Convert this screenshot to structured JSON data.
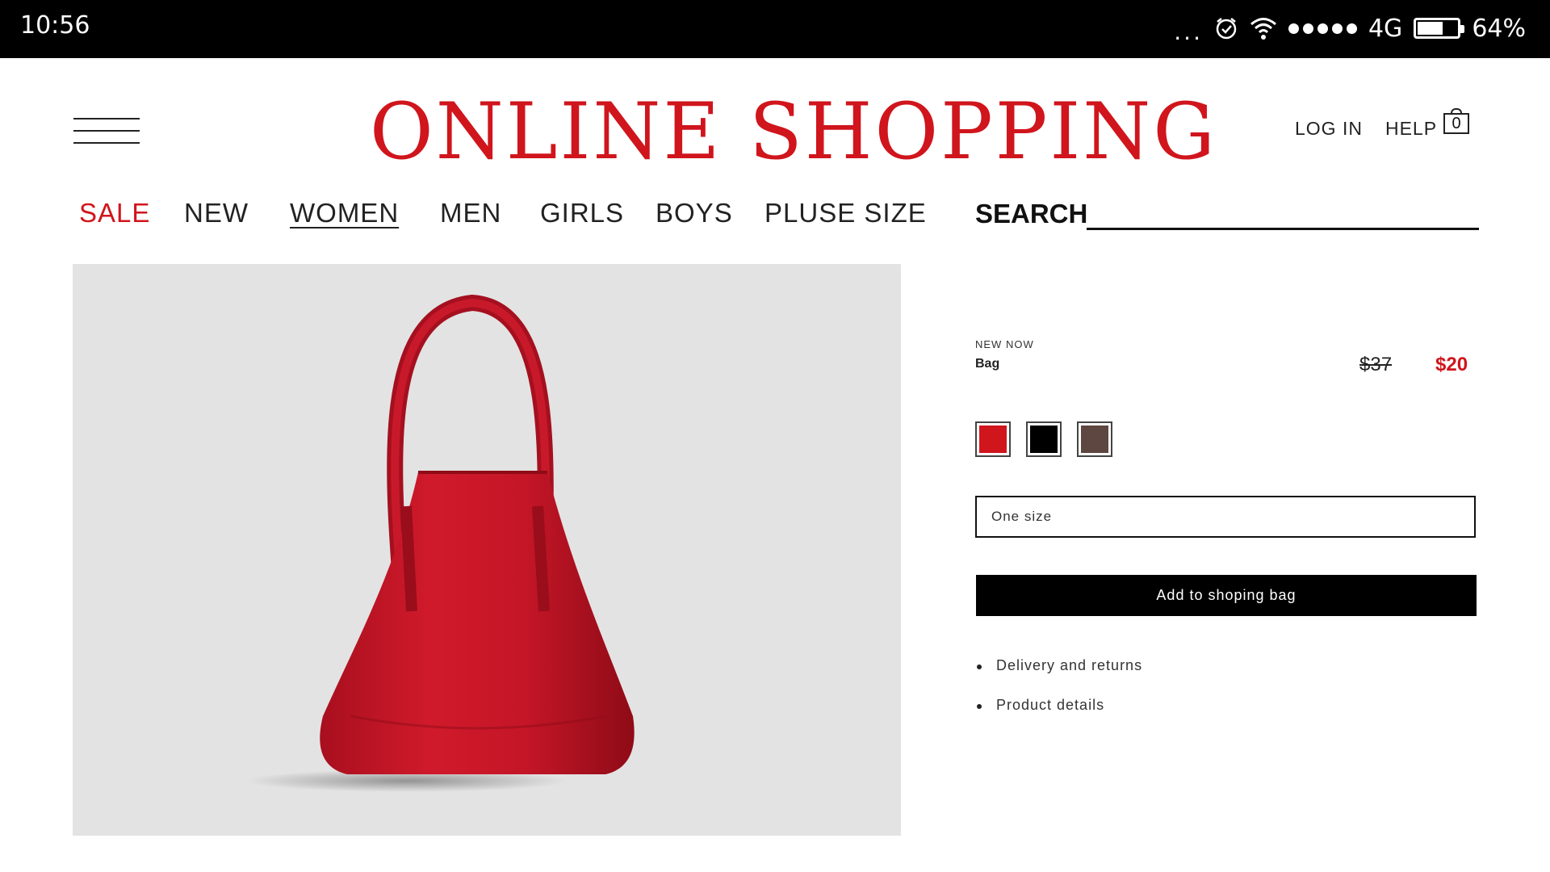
{
  "status_bar": {
    "time": "10:56",
    "more": "...",
    "network": "4G",
    "battery_percent": "64%",
    "battery_level": 0.64,
    "icons": [
      "alarm-icon",
      "wifi-icon",
      "signal-dots-icon",
      "battery-icon"
    ]
  },
  "header": {
    "title": "ONLINE SHOPPING",
    "login_label": "LOG IN",
    "help_label": "HELP",
    "cart_count": "0"
  },
  "nav": {
    "items": [
      {
        "label": "SALE"
      },
      {
        "label": "NEW"
      },
      {
        "label": "WOMEN"
      },
      {
        "label": "MEN"
      },
      {
        "label": "GIRLS"
      },
      {
        "label": "BOYS"
      },
      {
        "label": "PLUSE SIZE"
      }
    ],
    "active": "WOMEN"
  },
  "search": {
    "label": "SEARCH",
    "value": ""
  },
  "product": {
    "badge": "NEW NOW",
    "name": "Bag",
    "price_old": "$37",
    "price_new": "$20",
    "colors": [
      "#d0151c",
      "#000000",
      "#5d4740"
    ],
    "size": "One size",
    "add_button": "Add to shoping bag",
    "links": [
      "Delivery and returns",
      "Product details"
    ]
  },
  "colors": {
    "accent": "#d0151c",
    "image_background": "#e3e3e3"
  }
}
